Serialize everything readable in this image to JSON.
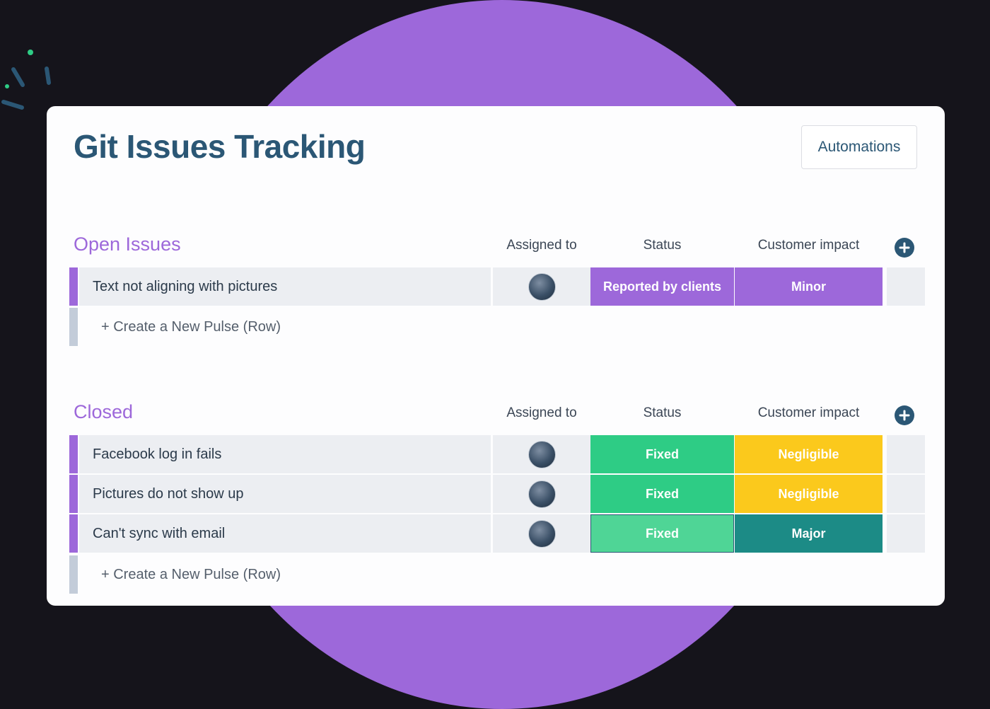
{
  "board": {
    "title": "Git Issues Tracking",
    "automations_label": "Automations"
  },
  "columns": {
    "assigned": "Assigned to",
    "status": "Status",
    "impact": "Customer impact"
  },
  "groups": [
    {
      "title": "Open Issues",
      "new_row_label": "+ Create a New Pulse (Row)",
      "rows": [
        {
          "name": "Text not aligning with pictures",
          "status": "Reported by clients",
          "status_color": "#9d68da",
          "impact": "Minor",
          "impact_color": "#9d68da"
        }
      ]
    },
    {
      "title": "Closed",
      "new_row_label": "+ Create a New Pulse (Row)",
      "rows": [
        {
          "name": "Facebook log in fails",
          "status": "Fixed",
          "status_color": "#2ecc85",
          "impact": "Negligible",
          "impact_color": "#fbc91c"
        },
        {
          "name": "Pictures do not show up",
          "status": "Fixed",
          "status_color": "#2ecc85",
          "impact": "Negligible",
          "impact_color": "#fbc91c"
        },
        {
          "name": "Can't sync with email",
          "status": "Fixed",
          "status_color": "#4fd596",
          "impact": "Major",
          "impact_color": "#1c8b86"
        }
      ]
    }
  ],
  "colors": {
    "background": "#15141b",
    "circle": "#9d68da",
    "title": "#2b5775",
    "group_accent": "#9d68da"
  },
  "icons": {
    "add_column": "plus-circle-icon",
    "avatar": "user-avatar"
  }
}
